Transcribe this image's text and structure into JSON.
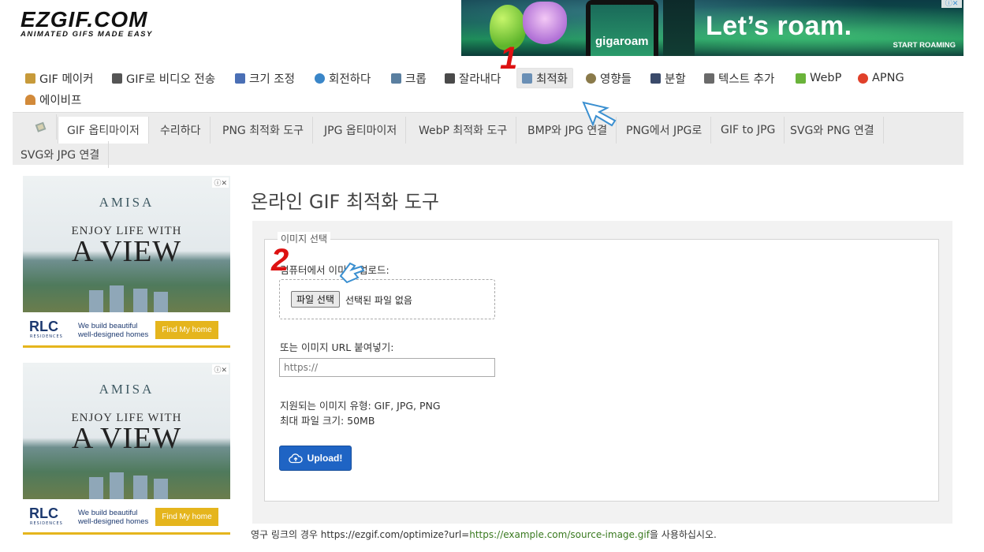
{
  "logo": {
    "title": "EZGIF.COM",
    "subtitle": "ANIMATED GIFS MADE EASY"
  },
  "top_ad": {
    "brand": "gigaroam",
    "headline": "Let’s roam.",
    "cta": "START ROAMING"
  },
  "main_nav": {
    "items": [
      {
        "label": "GIF 메이커",
        "icon": "gif-maker-icon",
        "color": "#c79a3a"
      },
      {
        "label": "GIF로 비디오 전송",
        "icon": "video-to-gif-icon",
        "color": "#555555"
      },
      {
        "label": "크기 조정",
        "icon": "resize-icon",
        "color": "#4a6fb5"
      },
      {
        "label": "회전하다",
        "icon": "rotate-icon",
        "color": "#3a86c8"
      },
      {
        "label": "크롭",
        "icon": "crop-icon",
        "color": "#5a7fa0"
      },
      {
        "label": "잘라내다",
        "icon": "cut-icon",
        "color": "#4a4a4a"
      },
      {
        "label": "최적화",
        "icon": "optimize-icon",
        "color": "#6a8fb5"
      },
      {
        "label": "영향들",
        "icon": "effects-icon",
        "color": "#8a7a4a"
      },
      {
        "label": "분할",
        "icon": "split-icon",
        "color": "#3a4a6a"
      },
      {
        "label": "텍스트 추가",
        "icon": "add-text-icon",
        "color": "#6a6a6a"
      },
      {
        "label": "WebP",
        "icon": "webp-icon",
        "color": "#6ab33a"
      },
      {
        "label": "APNG",
        "icon": "apng-icon",
        "color": "#e0402a"
      },
      {
        "label": "에이비프",
        "icon": "avif-icon",
        "color": "#d28a3a"
      }
    ],
    "active": "최적화"
  },
  "sub_nav": {
    "items": [
      "GIF 옵티마이저",
      "수리하다",
      "PNG 최적화 도구",
      "JPG 옵티마이저",
      "WebP 최적화 도구",
      "BMP와 JPG 연결",
      "PNG에서 JPG로",
      "GIF to JPG",
      "SVG와 PNG 연결",
      "SVG와 JPG 연결"
    ],
    "active": "GIF 옵티마이저"
  },
  "side_ad": {
    "brand": "AMISA",
    "line1": "ENJOY LIFE WITH",
    "line2": "A VIEW",
    "company": "RLC",
    "company_sub": "RESIDENCES",
    "tagline_1": "We build beautiful",
    "tagline_2": "well-designed homes",
    "button": "Find My home"
  },
  "page": {
    "title": "온라인 GIF 최적화 도구",
    "legend": "이미지 선택",
    "upload_label": "컴퓨터에서 이미지 업로드:",
    "file_button": "파일 선택",
    "file_status": "선택된 파일 없음",
    "url_label": "또는 이미지 URL 붙여넣기:",
    "url_placeholder": "https://",
    "supported": "지원되는 이미지 유형: GIF, JPG, PNG",
    "max_size": "최대 파일 크기: 50MB",
    "upload_button": "Upload!",
    "footer_prefix": "영구 링크의 경우 https://ezgif.com/optimize?url=",
    "footer_link": "https://example.com/source-image.gif",
    "footer_suffix": "을 사용하십시오."
  },
  "annotations": {
    "step1": "1",
    "step2": "2"
  },
  "colors": {
    "upload_button": "#1f64c4",
    "step_marker": "#dd1111",
    "link": "#3a7a20"
  }
}
